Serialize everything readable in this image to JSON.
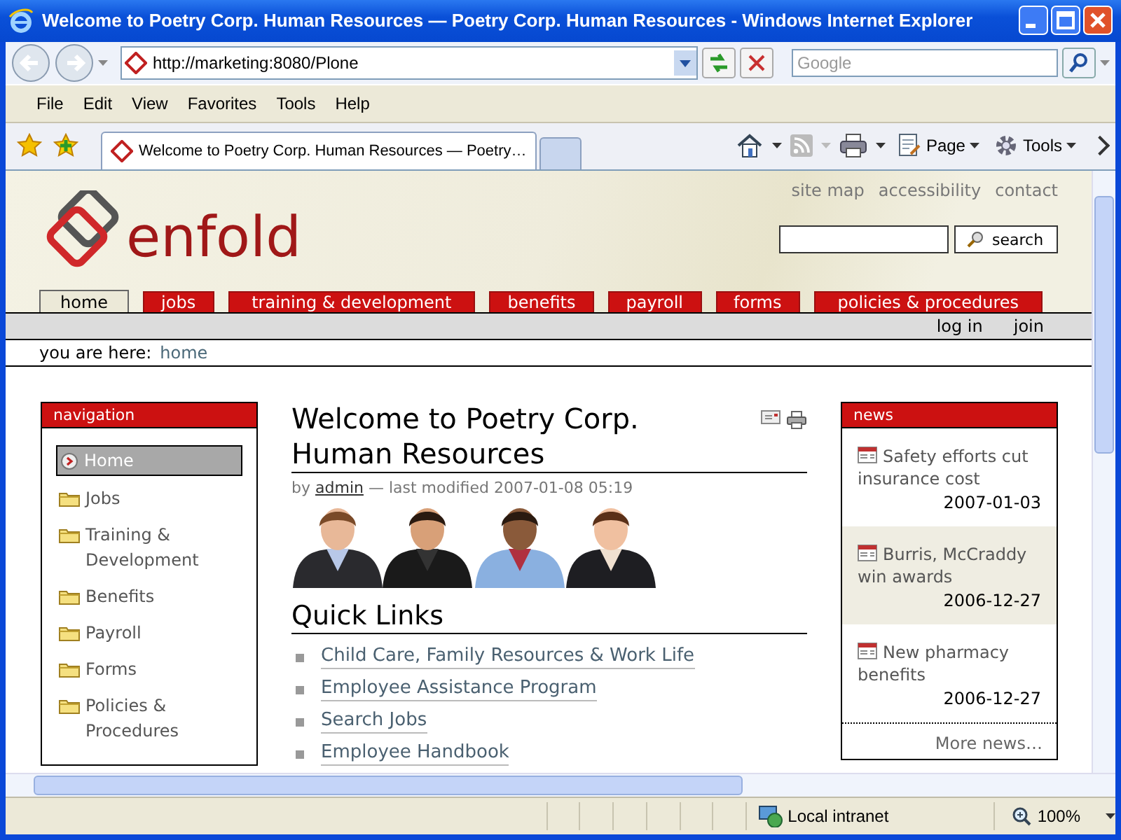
{
  "window": {
    "title": "Welcome to Poetry Corp. Human Resources — Poetry Corp. Human Resources - Windows Internet Explorer"
  },
  "address_bar": {
    "url": "http://marketing:8080/Plone"
  },
  "search": {
    "placeholder": "Google"
  },
  "menu": [
    "File",
    "Edit",
    "View",
    "Favorites",
    "Tools",
    "Help"
  ],
  "tabs": [
    {
      "label": "Welcome to Poetry Corp. Human Resources — Poetry…",
      "selected": true
    }
  ],
  "commands": [
    "Page",
    "Tools"
  ],
  "site": {
    "logo": "enfold",
    "site_actions": [
      "site map",
      "accessibility",
      "contact"
    ],
    "search_button": "search",
    "nav_tabs": [
      {
        "label": "home",
        "selected": true
      },
      {
        "label": "jobs",
        "selected": false
      },
      {
        "label": "training & development",
        "selected": false
      },
      {
        "label": "benefits",
        "selected": false
      },
      {
        "label": "payroll",
        "selected": false
      },
      {
        "label": "forms",
        "selected": false
      },
      {
        "label": "policies & procedures",
        "selected": false
      }
    ],
    "personal": [
      "log in",
      "join"
    ],
    "breadcrumb_label": "you are here:",
    "breadcrumb": "home"
  },
  "navigation": {
    "title": "navigation",
    "items": [
      {
        "label": "Home",
        "selected": true
      },
      {
        "label": "Jobs",
        "selected": false
      },
      {
        "label": "Training & Development",
        "selected": false
      },
      {
        "label": "Benefits",
        "selected": false
      },
      {
        "label": "Payroll",
        "selected": false
      },
      {
        "label": "Forms",
        "selected": false
      },
      {
        "label": "Policies & Procedures",
        "selected": false
      }
    ]
  },
  "content": {
    "title": "Welcome to Poetry Corp. Human Resources",
    "byline_prefix": "by",
    "author": "admin",
    "byline_suffix": "— last modified 2007-01-08 05:19",
    "quick_links_title": "Quick Links",
    "links": [
      "Child Care, Family Resources & Work Life",
      "Employee Assistance Program",
      "Search Jobs",
      "Employee Handbook"
    ]
  },
  "news": {
    "title": "news",
    "items": [
      {
        "title": "Safety efforts cut insurance cost",
        "date": "2007-01-03"
      },
      {
        "title": "Burris, McCraddy win awards",
        "date": "2006-12-27"
      },
      {
        "title": "New pharmacy benefits",
        "date": "2006-12-27"
      }
    ],
    "more": "More news…"
  },
  "status": {
    "zone": "Local intranet",
    "zoom": "100%"
  }
}
